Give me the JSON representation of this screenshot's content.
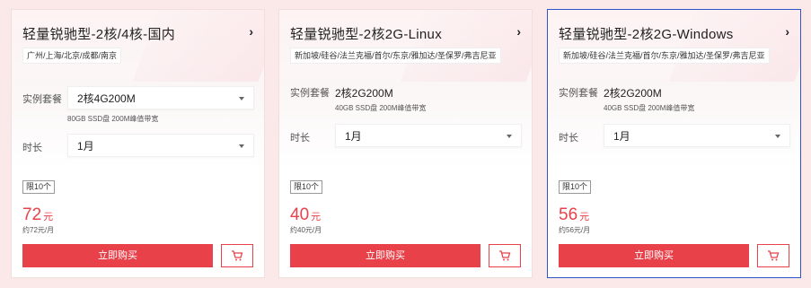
{
  "cards": [
    {
      "title": "轻量锐驰型-2核/4核-国内",
      "regions": "广州/上海/北京/成都/南京",
      "package_label": "实例套餐",
      "package_value": "2核4G200M",
      "spec": "80GB SSD盘 200M峰值带宽",
      "duration_label": "时长",
      "duration_value": "1月",
      "limit": "限10个",
      "price": "72",
      "price_unit": "元",
      "per_month": "约72元/月",
      "buy_label": "立即购买"
    },
    {
      "title": "轻量锐驰型-2核2G-Linux",
      "regions": "新加坡/硅谷/法兰克福/首尔/东京/雅加达/圣保罗/弗吉尼亚",
      "package_label": "实例套餐",
      "package_value": "2核2G200M",
      "spec": "40GB SSD盘 200M峰值带宽",
      "duration_label": "时长",
      "duration_value": "1月",
      "limit": "限10个",
      "price": "40",
      "price_unit": "元",
      "per_month": "约40元/月",
      "buy_label": "立即购买"
    },
    {
      "title": "轻量锐驰型-2核2G-Windows",
      "regions": "新加坡/硅谷/法兰克福/首尔/东京/雅加达/圣保罗/弗吉尼亚",
      "package_label": "实例套餐",
      "package_value": "2核2G200M",
      "spec": "40GB SSD盘 200M峰值带宽",
      "duration_label": "时长",
      "duration_value": "1月",
      "limit": "限10个",
      "price": "56",
      "price_unit": "元",
      "per_month": "约56元/月",
      "buy_label": "立即购买"
    }
  ],
  "icons": {
    "arrow": "chevron-right-icon",
    "cart": "cart-icon"
  },
  "colors": {
    "accent": "#e8414a",
    "selected_border": "#2f55c8"
  }
}
